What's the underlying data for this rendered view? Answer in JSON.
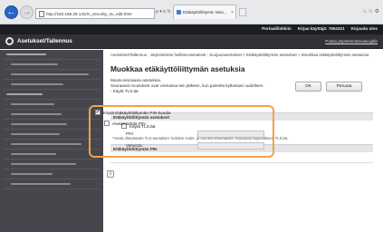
{
  "browser": {
    "url": "http://192.168.25.131/m_security_nu_edit.html",
    "tab_label": "Etäkäyttöliittymä: Muo...",
    "address_tools": "ρ ▾ ≡ ↻",
    "tab_close": "×",
    "window_icons": "⌂ ☆ ⚙"
  },
  "top_links": {
    "portal_label": "Portaalilinkkiin",
    "login_user_label": "Kirjaa käyttäjä:",
    "login_user_value": "7654321",
    "logout_label": "Kirjaudu ulos"
  },
  "header": {
    "title": "Asetukset/Tallennus",
    "portal_link": "Postia järjestelmänvalvojalle"
  },
  "main": {
    "breadcrumb": "Asetukset/Tallennus : Järjestelmän hallinta-asetukset : Suojausasetukset > Etäkäyttöliittymän asetukset > Muokkaa etäkäyttöliittymän asetuksia",
    "title": "Muokkaa etäkäyttöliittymän asetuksia",
    "notice_line1": "Muuta seuraavia asetuksia.",
    "notice_line2": "Seuraavat muutokset ovat voimassa sen jälkeen, kun painetta kytketaan uudelleen.",
    "notice_line3": "- Käytä TLS:ää",
    "ok_label": "OK",
    "cancel_label": "Peruuta",
    "tls_section": "Etäkäyttöliittymän asetukset",
    "tls_checkbox": "Käytä TLS:ää",
    "tls_note": "*Aseta oletusavain TLS-asetukset -kohdan Avain- ja varmenneasetukset -kohdassa käyttääksesi TLS:ää.",
    "pin_section": "Etäkäyttöliittymän PIN",
    "pin_enable": "Käytä Etäkäyttöliittymän PIN-koodia",
    "pin_enable_check": "✔",
    "set_pin": "Aseta/Vaihda PIN",
    "pin_label": "PIN:",
    "confirm_label": "Vahvista:",
    "page_top_glyph": "⇧"
  }
}
